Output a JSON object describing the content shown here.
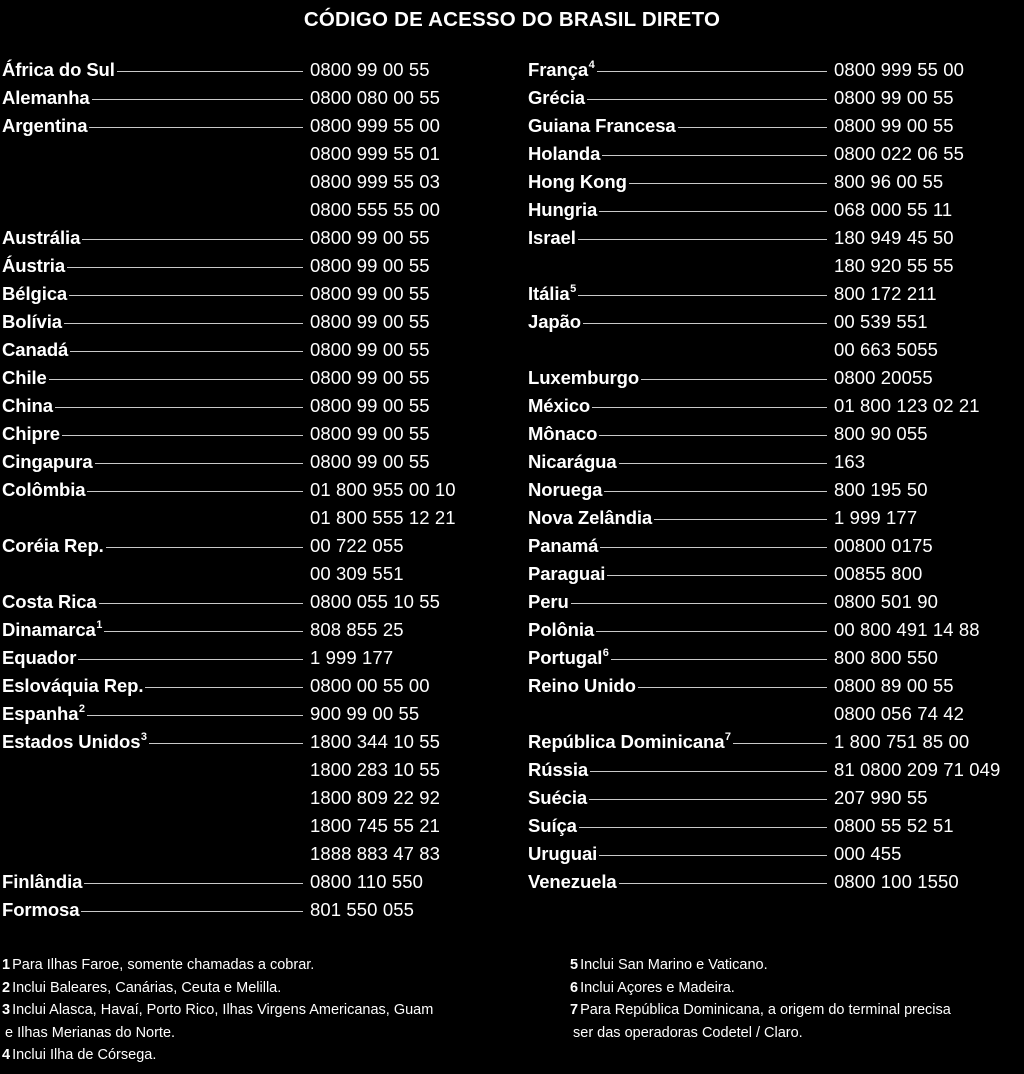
{
  "header": {
    "title": "CÓDIGO DE ACESSO DO BRASIL DIRETO"
  },
  "left_column": [
    {
      "country": "África do Sul",
      "note": "",
      "number": "0800 99 00 55"
    },
    {
      "country": "Alemanha",
      "note": "",
      "number": "0800 080 00 55"
    },
    {
      "country": "Argentina",
      "note": "",
      "number": "0800 999 55 00"
    },
    {
      "country": "",
      "note": "",
      "number": "0800 999 55 01"
    },
    {
      "country": "",
      "note": "",
      "number": "0800 999 55 03"
    },
    {
      "country": "",
      "note": "",
      "number": "0800 555 55 00"
    },
    {
      "country": "Austrália",
      "note": "",
      "number": "0800 99 00 55"
    },
    {
      "country": "Áustria",
      "note": "",
      "number": "0800 99 00 55"
    },
    {
      "country": "Bélgica",
      "note": "",
      "number": "0800 99 00 55"
    },
    {
      "country": "Bolívia",
      "note": "",
      "number": "0800 99 00 55"
    },
    {
      "country": "Canadá",
      "note": "",
      "number": "0800 99 00 55"
    },
    {
      "country": "Chile",
      "note": "",
      "number": "0800 99 00 55"
    },
    {
      "country": "China",
      "note": "",
      "number": "0800 99 00 55"
    },
    {
      "country": "Chipre",
      "note": "",
      "number": "0800 99 00 55"
    },
    {
      "country": "Cingapura",
      "note": "",
      "number": "0800 99 00 55"
    },
    {
      "country": "Colômbia",
      "note": "",
      "number": "01 800 955 00 10"
    },
    {
      "country": "",
      "note": "",
      "number": "01 800 555 12 21"
    },
    {
      "country": "Coréia Rep.",
      "note": "",
      "number": "00 722 055"
    },
    {
      "country": "",
      "note": "",
      "number": "00 309 551"
    },
    {
      "country": "Costa Rica",
      "note": "",
      "number": "0800 055 10 55"
    },
    {
      "country": "Dinamarca",
      "note": "1",
      "number": "808 855 25"
    },
    {
      "country": "Equador",
      "note": "",
      "number": "1 999 177"
    },
    {
      "country": "Eslováquia Rep.",
      "note": "",
      "number": "0800 00 55 00"
    },
    {
      "country": "Espanha",
      "note": "2",
      "number": "900 99 00 55"
    },
    {
      "country": "Estados Unidos",
      "note": "3",
      "number": "1800 344 10 55"
    },
    {
      "country": "",
      "note": "",
      "number": "1800 283 10 55"
    },
    {
      "country": "",
      "note": "",
      "number": "1800 809 22 92"
    },
    {
      "country": "",
      "note": "",
      "number": "1800 745 55 21"
    },
    {
      "country": "",
      "note": "",
      "number": "1888 883 47 83"
    },
    {
      "country": "Finlândia",
      "note": "",
      "number": "0800 110 550"
    },
    {
      "country": "Formosa",
      "note": "",
      "number": "801 550 055"
    }
  ],
  "right_column": [
    {
      "country": "França",
      "note": "4",
      "number": "0800 999 55 00"
    },
    {
      "country": "Grécia",
      "note": "",
      "number": "0800 99 00 55"
    },
    {
      "country": "Guiana Francesa",
      "note": "",
      "number": "0800 99 00 55"
    },
    {
      "country": "Holanda",
      "note": "",
      "number": "0800 022 06 55"
    },
    {
      "country": "Hong Kong",
      "note": "",
      "number": "800 96 00 55"
    },
    {
      "country": "Hungria",
      "note": "",
      "number": "068 000 55 11"
    },
    {
      "country": "Israel",
      "note": "",
      "number": "180 949 45 50"
    },
    {
      "country": "",
      "note": "",
      "number": "180 920 55 55"
    },
    {
      "country": "Itália",
      "note": "5",
      "number": "800 172 211"
    },
    {
      "country": "Japão",
      "note": "",
      "number": "00 539 551"
    },
    {
      "country": "",
      "note": "",
      "number": "00 663 5055"
    },
    {
      "country": "Luxemburgo",
      "note": "",
      "number": "0800 20055"
    },
    {
      "country": "México",
      "note": "",
      "number": "01 800 123 02 21"
    },
    {
      "country": "Mônaco",
      "note": "",
      "number": "800 90 055"
    },
    {
      "country": "Nicarágua",
      "note": "",
      "number": "163"
    },
    {
      "country": "Noruega",
      "note": "",
      "number": "800 195 50"
    },
    {
      "country": "Nova Zelândia",
      "note": "",
      "number": "1 999 177"
    },
    {
      "country": "Panamá",
      "note": "",
      "number": "00800 0175"
    },
    {
      "country": "Paraguai",
      "note": "",
      "number": "00855 800"
    },
    {
      "country": "Peru",
      "note": "",
      "number": "0800 501 90"
    },
    {
      "country": "Polônia",
      "note": "",
      "number": "00 800 491 14 88"
    },
    {
      "country": "Portugal",
      "note": "6",
      "number": "800 800 550"
    },
    {
      "country": "Reino Unido",
      "note": "",
      "number": "0800 89 00 55"
    },
    {
      "country": "",
      "note": "",
      "number": "0800 056 74 42"
    },
    {
      "country": "República Dominicana",
      "note": "7",
      "number": "1 800 751 85 00"
    },
    {
      "country": "Rússia",
      "note": "",
      "number": "81 0800 209 71 049"
    },
    {
      "country": "Suécia",
      "note": "",
      "number": "207 990 55"
    },
    {
      "country": "Suíça",
      "note": "",
      "number": "0800 55 52 51"
    },
    {
      "country": "Uruguai",
      "note": "",
      "number": "000 455"
    },
    {
      "country": "Venezuela",
      "note": "",
      "number": "0800 100 1550"
    }
  ],
  "footnotes_left": [
    {
      "num": "1",
      "text": "Para Ilhas Faroe, somente chamadas a cobrar.",
      "cont": ""
    },
    {
      "num": "2",
      "text": "Inclui Baleares, Canárias, Ceuta e Melilla.",
      "cont": ""
    },
    {
      "num": "3",
      "text": "Inclui Alasca, Havaí, Porto Rico, Ilhas Virgens Americanas, Guam",
      "cont": "e Ilhas Merianas do Norte."
    },
    {
      "num": "4",
      "text": "Inclui Ilha de Córsega.",
      "cont": ""
    }
  ],
  "footnotes_right": [
    {
      "num": "5",
      "text": "Inclui San Marino e Vaticano.",
      "cont": ""
    },
    {
      "num": "6",
      "text": "Inclui Açores e Madeira.",
      "cont": ""
    },
    {
      "num": "7",
      "text": "Para República Dominicana, a origem do terminal precisa",
      "cont": "ser das operadoras Codetel / Claro."
    }
  ],
  "colors": {
    "background": "#000000",
    "text": "#ffffff",
    "leader": "#c9c9c9"
  }
}
